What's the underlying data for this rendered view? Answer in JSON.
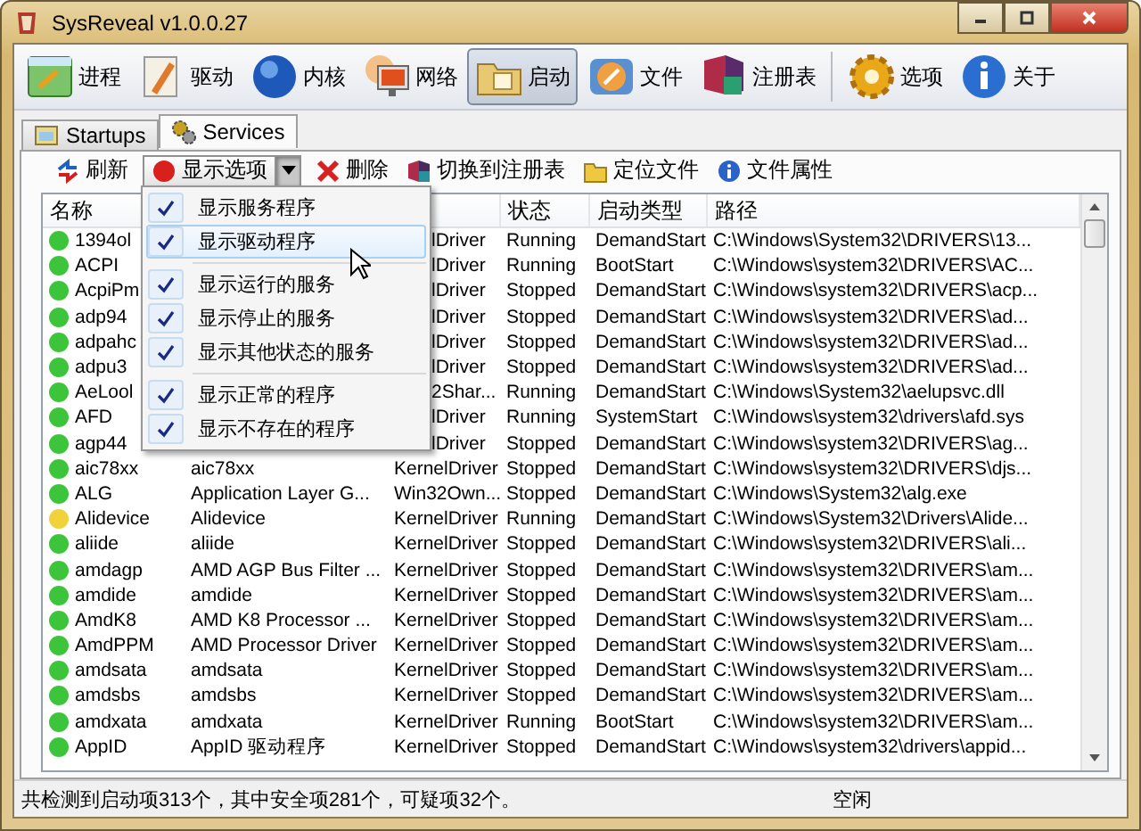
{
  "window": {
    "title": "SysReveal v1.0.0.27"
  },
  "toolbar": [
    {
      "label": "进程",
      "selected": false
    },
    {
      "label": "驱动",
      "selected": false
    },
    {
      "label": "内核",
      "selected": false
    },
    {
      "label": "网络",
      "selected": false
    },
    {
      "label": "启动",
      "selected": true
    },
    {
      "label": "文件",
      "selected": false
    },
    {
      "label": "注册表",
      "selected": false
    },
    {
      "label": "选项",
      "selected": false
    },
    {
      "label": "关于",
      "selected": false
    }
  ],
  "tabs": [
    {
      "label": "Startups",
      "selected": false
    },
    {
      "label": "Services",
      "selected": true
    }
  ],
  "actions": [
    {
      "label": "刷新",
      "kind": "button"
    },
    {
      "label": "显示选项",
      "kind": "split",
      "expanded": true
    },
    {
      "label": "删除",
      "kind": "button"
    },
    {
      "label": "切换到注册表",
      "kind": "button"
    },
    {
      "label": "定位文件",
      "kind": "button"
    },
    {
      "label": "文件属性",
      "kind": "button"
    }
  ],
  "menu": {
    "groups": [
      [
        {
          "label": "显示服务程序",
          "checked": true,
          "selected": false
        },
        {
          "label": "显示驱动程序",
          "checked": true,
          "selected": true
        }
      ],
      [
        {
          "label": "显示运行的服务",
          "checked": true,
          "selected": false
        },
        {
          "label": "显示停止的服务",
          "checked": true,
          "selected": false
        },
        {
          "label": "显示其他状态的服务",
          "checked": true,
          "selected": false
        }
      ],
      [
        {
          "label": "显示正常的程序",
          "checked": true,
          "selected": false
        },
        {
          "label": "显示不存在的程序",
          "checked": true,
          "selected": false
        }
      ]
    ]
  },
  "table": {
    "columns": [
      {
        "label": "名称"
      },
      {
        "label": "状态"
      },
      {
        "label": "启动类型"
      },
      {
        "label": "路径"
      }
    ],
    "rows": [
      {
        "name": "1394ol",
        "type": "lDriver",
        "status": "Running",
        "start_type": "DemandStart",
        "path": "C:\\Windows\\System32\\DRIVERS\\13...",
        "color": "#3cc43a"
      },
      {
        "name": "ACPI",
        "type": "lDriver",
        "status": "Running",
        "start_type": "BootStart",
        "path": "C:\\Windows\\system32\\DRIVERS\\AC...",
        "color": "#3cc43a"
      },
      {
        "name": "AcpiPm",
        "type": "lDriver",
        "status": "Stopped",
        "start_type": "DemandStart",
        "path": "C:\\Windows\\system32\\DRIVERS\\acp...",
        "color": "#3cc43a"
      },
      {
        "name": "adp94",
        "type": "lDriver",
        "status": "Stopped",
        "start_type": "DemandStart",
        "path": "C:\\Windows\\system32\\DRIVERS\\ad...",
        "color": "#3cc43a"
      },
      {
        "name": "adpahc",
        "type": "lDriver",
        "status": "Stopped",
        "start_type": "DemandStart",
        "path": "C:\\Windows\\system32\\DRIVERS\\ad...",
        "color": "#3cc43a"
      },
      {
        "name": "adpu3",
        "type": "lDriver",
        "status": "Stopped",
        "start_type": "DemandStart",
        "path": "C:\\Windows\\system32\\DRIVERS\\ad...",
        "color": "#3cc43a"
      },
      {
        "name": "AeLool",
        "type": "2Shar...",
        "status": "Running",
        "start_type": "DemandStart",
        "path": "C:\\Windows\\System32\\aelupsvc.dll",
        "color": "#3cc43a"
      },
      {
        "name": "AFD",
        "type": "lDriver",
        "status": "Running",
        "start_type": "SystemStart",
        "path": "C:\\Windows\\system32\\drivers\\afd.sys",
        "color": "#3cc43a"
      },
      {
        "name": "agp44",
        "type": "lDriver",
        "status": "Stopped",
        "start_type": "DemandStart",
        "path": "C:\\Windows\\system32\\DRIVERS\\ag...",
        "color": "#3cc43a"
      },
      {
        "name": "aic78xx",
        "display": "aic78xx",
        "type": "KernelDriver",
        "status": "Stopped",
        "start_type": "DemandStart",
        "path": "C:\\Windows\\system32\\DRIVERS\\djs...",
        "color": "#3cc43a"
      },
      {
        "name": "ALG",
        "display": "Application Layer G...",
        "type": "Win32Own...",
        "status": "Stopped",
        "start_type": "DemandStart",
        "path": "C:\\Windows\\System32\\alg.exe",
        "color": "#3cc43a"
      },
      {
        "name": "Alidevice",
        "display": "Alidevice",
        "type": "KernelDriver",
        "status": "Running",
        "start_type": "DemandStart",
        "path": "C:\\Windows\\System32\\Drivers\\Alide...",
        "color": "#f0d23a"
      },
      {
        "name": "aliide",
        "display": "aliide",
        "type": "KernelDriver",
        "status": "Stopped",
        "start_type": "DemandStart",
        "path": "C:\\Windows\\system32\\DRIVERS\\ali...",
        "color": "#3cc43a"
      },
      {
        "name": "amdagp",
        "display": "AMD AGP Bus Filter ...",
        "type": "KernelDriver",
        "status": "Stopped",
        "start_type": "DemandStart",
        "path": "C:\\Windows\\system32\\DRIVERS\\am...",
        "color": "#3cc43a"
      },
      {
        "name": "amdide",
        "display": "amdide",
        "type": "KernelDriver",
        "status": "Stopped",
        "start_type": "DemandStart",
        "path": "C:\\Windows\\system32\\DRIVERS\\am...",
        "color": "#3cc43a"
      },
      {
        "name": "AmdK8",
        "display": "AMD K8 Processor ...",
        "type": "KernelDriver",
        "status": "Stopped",
        "start_type": "DemandStart",
        "path": "C:\\Windows\\system32\\DRIVERS\\am...",
        "color": "#3cc43a"
      },
      {
        "name": "AmdPPM",
        "display": "AMD Processor Driver",
        "type": "KernelDriver",
        "status": "Stopped",
        "start_type": "DemandStart",
        "path": "C:\\Windows\\system32\\DRIVERS\\am...",
        "color": "#3cc43a"
      },
      {
        "name": "amdsata",
        "display": "amdsata",
        "type": "KernelDriver",
        "status": "Stopped",
        "start_type": "DemandStart",
        "path": "C:\\Windows\\system32\\DRIVERS\\am...",
        "color": "#3cc43a"
      },
      {
        "name": "amdsbs",
        "display": "amdsbs",
        "type": "KernelDriver",
        "status": "Stopped",
        "start_type": "DemandStart",
        "path": "C:\\Windows\\system32\\DRIVERS\\am...",
        "color": "#3cc43a"
      },
      {
        "name": "amdxata",
        "display": "amdxata",
        "type": "KernelDriver",
        "status": "Running",
        "start_type": "BootStart",
        "path": "C:\\Windows\\system32\\DRIVERS\\am...",
        "color": "#3cc43a"
      },
      {
        "name": "AppID",
        "display": "AppID 驱动程序",
        "type": "KernelDriver",
        "status": "Stopped",
        "start_type": "DemandStart",
        "path": "C:\\Windows\\system32\\drivers\\appid...",
        "color": "#3cc43a"
      }
    ]
  },
  "status_bar": {
    "message": "共检测到启动项313个，其中安全项281个，可疑项32个。",
    "state": "空闲"
  }
}
